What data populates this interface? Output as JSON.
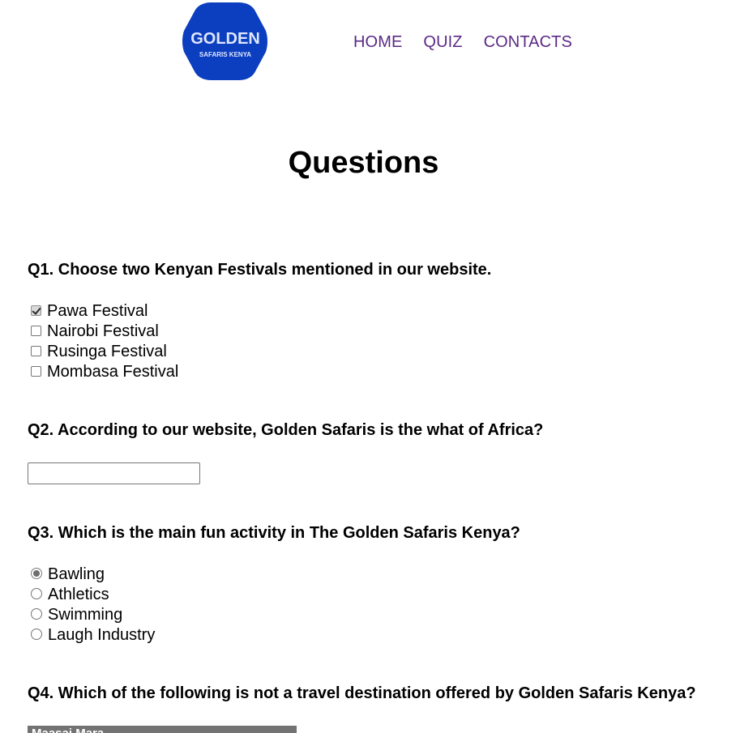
{
  "logo": {
    "line1": "GOLDEN",
    "line2": "SAFARIS KENYA",
    "color": "#0b3fbf"
  },
  "nav": {
    "home": "HOME",
    "quiz": "QUIZ",
    "contacts": "CONTACTS",
    "link_color": "#5b2a86"
  },
  "page": {
    "title": "Questions"
  },
  "q1": {
    "text": "Q1. Choose two Kenyan Festivals mentioned in our website.",
    "options": [
      {
        "label": "Pawa Festival",
        "checked": true
      },
      {
        "label": "Nairobi Festival",
        "checked": false
      },
      {
        "label": "Rusinga Festival",
        "checked": false
      },
      {
        "label": "Mombasa Festival",
        "checked": false
      }
    ]
  },
  "q2": {
    "text": "Q2. According to our website, Golden Safaris is the what of Africa?",
    "value": ""
  },
  "q3": {
    "text": "Q3. Which is the main fun activity in The Golden Safaris Kenya?",
    "options": [
      {
        "label": "Bawling",
        "checked": true
      },
      {
        "label": "Athletics",
        "checked": false
      },
      {
        "label": "Swimming",
        "checked": false
      },
      {
        "label": "Laugh Industry",
        "checked": false
      }
    ]
  },
  "q4": {
    "text": "Q4. Which of the following is not a travel destination offered by Golden Safaris Kenya?",
    "selected": "Maasai Mara"
  }
}
